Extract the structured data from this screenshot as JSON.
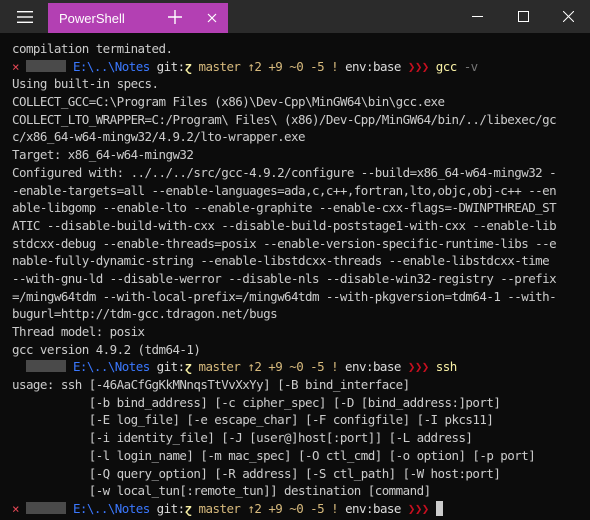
{
  "window": {
    "tab_title": "PowerShell"
  },
  "colors": {
    "tab_accent": "#b340b3",
    "titlebar": "#2b2b2b",
    "terminal_bg": "#0c0c0c",
    "path": "#3b78ff",
    "branch": "#d7ba7d",
    "command": "#f9f1a5",
    "error_x": "#e74856"
  },
  "icons": {
    "menu": "hamburger-icon",
    "tab_close": "close-icon",
    "new_tab": "plus-icon",
    "minimize": "minimize-icon",
    "maximize": "maximize-icon",
    "close": "close-icon"
  },
  "prompt": {
    "error_mark": "×",
    "path": "E:\\..\\Notes",
    "git_label": "git:",
    "git_symbol": "ɀ",
    "branch": "master",
    "status": "↑2 +9 ~0 -5 !",
    "env": "env:base",
    "arrows": "❯❯❯"
  },
  "commands": {
    "gcc": "gcc",
    "gcc_flag": "-v",
    "ssh": "ssh"
  },
  "output": {
    "first_line": "compilation terminated.",
    "gcc_lines": [
      "Using built-in specs.",
      "COLLECT_GCC=C:\\Program Files (x86)\\Dev-Cpp\\MinGW64\\bin\\gcc.exe",
      "COLLECT_LTO_WRAPPER=C:/Program\\ Files\\ (x86)/Dev-Cpp/MinGW64/bin/../libexec/gc",
      "c/x86_64-w64-mingw32/4.9.2/lto-wrapper.exe",
      "Target: x86_64-w64-mingw32",
      "Configured with: ../../../src/gcc-4.9.2/configure --build=x86_64-w64-mingw32 -",
      "-enable-targets=all --enable-languages=ada,c,c++,fortran,lto,objc,obj-c++ --en",
      "able-libgomp --enable-lto --enable-graphite --enable-cxx-flags=-DWINPTHREAD_ST",
      "ATIC --disable-build-with-cxx --disable-build-poststage1-with-cxx --enable-lib",
      "stdcxx-debug --enable-threads=posix --enable-version-specific-runtime-libs --e",
      "nable-fully-dynamic-string --enable-libstdcxx-threads --enable-libstdcxx-time",
      "--with-gnu-ld --disable-werror --disable-nls --disable-win32-registry --prefix",
      "=/mingw64tdm --with-local-prefix=/mingw64tdm --with-pkgversion=tdm64-1 --with-",
      "bugurl=http://tdm-gcc.tdragon.net/bugs",
      "Thread model: posix",
      "gcc version 4.9.2 (tdm64-1)"
    ],
    "ssh_lines": [
      "usage: ssh [-46AaCfGgKkMNnqsTtVvXxYy] [-B bind_interface]",
      "           [-b bind_address] [-c cipher_spec] [-D [bind_address:]port]",
      "           [-E log_file] [-e escape_char] [-F configfile] [-I pkcs11]",
      "           [-i identity_file] [-J [user@]host[:port]] [-L address]",
      "           [-l login_name] [-m mac_spec] [-O ctl_cmd] [-o option] [-p port]",
      "           [-Q query_option] [-R address] [-S ctl_path] [-W host:port]",
      "           [-w local_tun[:remote_tun]] destination [command]"
    ]
  }
}
